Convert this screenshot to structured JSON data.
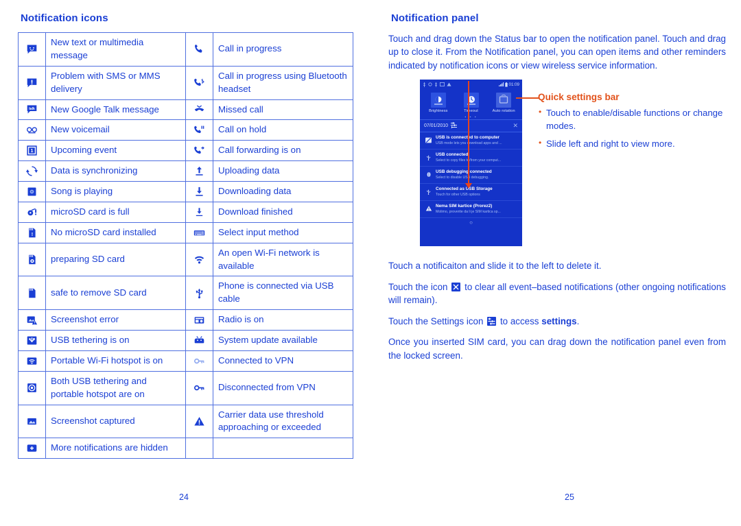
{
  "left_page": {
    "title": "Notification icons",
    "page_number": "24",
    "rows": [
      {
        "left_icon": "sms-message-icon",
        "left_label": "New text or multimedia message",
        "right_icon": "phone-call-icon",
        "right_label": "Call in progress"
      },
      {
        "left_icon": "sms-problem-icon",
        "left_label": "Problem with SMS or MMS delivery",
        "right_icon": "phone-bluetooth-icon",
        "right_label": "Call in progress using Bluetooth headset"
      },
      {
        "left_icon": "google-talk-icon",
        "left_label": "New Google Talk message",
        "right_icon": "missed-call-icon",
        "right_label": "Missed call"
      },
      {
        "left_icon": "voicemail-icon",
        "left_label": "New voicemail",
        "right_icon": "call-hold-icon",
        "right_label": "Call on hold"
      },
      {
        "left_icon": "calendar-event-icon",
        "left_label": "Upcoming event",
        "right_icon": "call-forward-icon",
        "right_label": "Call forwarding is on"
      },
      {
        "left_icon": "sync-icon",
        "left_label": "Data is synchronizing",
        "right_icon": "upload-icon",
        "right_label": "Uploading data"
      },
      {
        "left_icon": "music-play-icon",
        "left_label": "Song is playing",
        "right_icon": "download-icon",
        "right_label": "Downloading data"
      },
      {
        "left_icon": "sd-card-full-icon",
        "left_label": "microSD card is full",
        "right_icon": "download-finished-icon",
        "right_label": "Download finished"
      },
      {
        "left_icon": "no-sd-card-icon",
        "left_label": "No microSD card installed",
        "right_icon": "keyboard-icon",
        "right_label": "Select input method"
      },
      {
        "left_icon": "preparing-sd-card-icon",
        "left_label": "preparing SD card",
        "right_icon": "wifi-open-icon",
        "right_label": "An open Wi-Fi network is available"
      },
      {
        "left_icon": "safe-remove-sd-icon",
        "left_label": "safe to remove SD card",
        "right_icon": "usb-icon",
        "right_label": "Phone is connected via USB cable"
      },
      {
        "left_icon": "screenshot-error-icon",
        "left_label": "Screenshot error",
        "right_icon": "radio-icon",
        "right_label": "Radio is on"
      },
      {
        "left_icon": "usb-tethering-icon",
        "left_label": "USB tethering is on",
        "right_icon": "system-update-icon",
        "right_label": "System update available"
      },
      {
        "left_icon": "wifi-hotspot-icon",
        "left_label": "Portable Wi-Fi hotspot is on",
        "right_icon": "vpn-connected-icon",
        "right_label": "Connected to VPN"
      },
      {
        "left_icon": "usb-tethering-hotspot-icon",
        "left_label": "Both USB tethering and portable hotspot are on",
        "right_icon": "vpn-disconnected-icon",
        "right_label": "Disconnected from VPN"
      },
      {
        "left_icon": "screenshot-captured-icon",
        "left_label": "Screenshot captured",
        "right_icon": "warning-icon",
        "right_label": "Carrier data use threshold approaching or exceeded"
      },
      {
        "left_icon": "more-notifications-icon",
        "left_label": "More notifications are hidden",
        "right_icon": "",
        "right_label": ""
      }
    ]
  },
  "right_page": {
    "title": "Notification panel",
    "page_number": "25",
    "intro": "Touch and drag down the Status bar to open the notification panel. Touch and drag up to close it. From the Notification panel, you can open items and other reminders indicated by notification icons or view wireless service information.",
    "callout": {
      "title": "Quick settings bar",
      "bullets": [
        "Touch to enable/disable functions or change modes.",
        "Slide left and right to view more."
      ]
    },
    "phone_screenshot": {
      "status_time": "01:09",
      "quick_settings": [
        {
          "label": "Brightness",
          "icon": "brightness-icon"
        },
        {
          "label": "Timeout",
          "icon": "timeout-icon"
        },
        {
          "label": "Auto rotation",
          "icon": "auto-rotation-icon"
        }
      ],
      "date": "07/01/2010",
      "settings_icon": "settings-icon",
      "close_icon": "close-icon",
      "notifications": [
        {
          "icon": "usb-computer-icon",
          "title": "USB is connected to computer",
          "subtitle": "USB mode lets you download apps and ..."
        },
        {
          "icon": "usb-icon",
          "title": "USB connected",
          "subtitle": "Select to copy files to/from your comput..."
        },
        {
          "icon": "usb-debug-icon",
          "title": "USB debugging connected",
          "subtitle": "Select to disable USB debugging."
        },
        {
          "icon": "usb-icon",
          "title": "Connected as USB Storage",
          "subtitle": "Touch for other USB options"
        },
        {
          "icon": "warning-icon",
          "title": "Nema SIM kartice (Prorez2)",
          "subtitle": "Molimo, proverite da li je SIM kartica sp..."
        }
      ],
      "home_icon": "home-circle-icon"
    },
    "paragraphs": [
      {
        "id": "p1",
        "text": "Touch a notificaiton and slide it to the left to delete it."
      },
      {
        "id": "p2_a",
        "text": "Touch the icon"
      },
      {
        "id": "p2_b",
        "text": "to clear all event–based notifications (other ongoing notifications will remain)."
      },
      {
        "id": "p3_a",
        "text": "Touch the Settings icon"
      },
      {
        "id": "p3_b",
        "text": "to access"
      },
      {
        "id": "p3_c",
        "text": "settings"
      },
      {
        "id": "p3_d",
        "text": "."
      },
      {
        "id": "p4",
        "text": "Once you inserted SIM card, you can drag down the notification panel even from the locked screen."
      }
    ]
  },
  "colors": {
    "text_blue": "#1a3fd4",
    "accent_orange": "#e2521b",
    "phone_bg": "#1433c8",
    "table_border": "#4f6fe0"
  }
}
